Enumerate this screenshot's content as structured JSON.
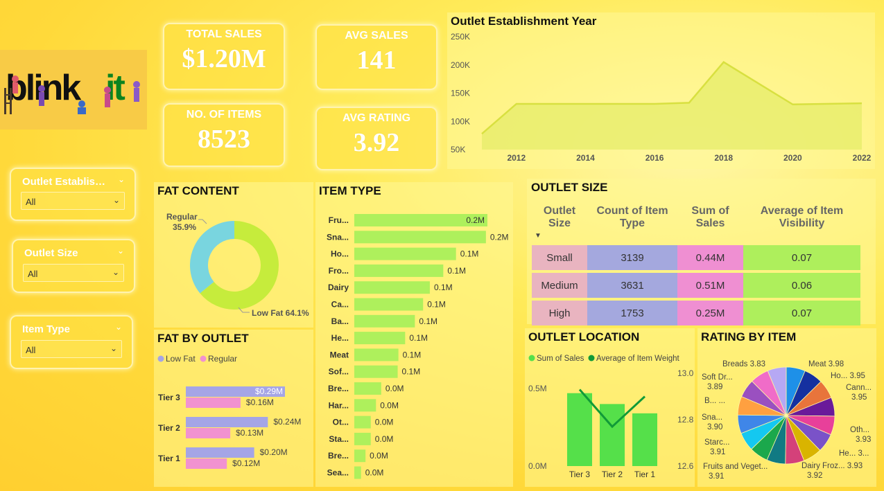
{
  "brand": {
    "logo_text": "blinkit",
    "logo_text_a": "blink",
    "logo_text_b": "it",
    "logo_bg": "#f8cb46",
    "logo_dark": "#111111",
    "logo_green": "#0c831f"
  },
  "kpis": {
    "total_sales": {
      "label": "TOTAL SALES",
      "value": "$1.20M"
    },
    "avg_sales": {
      "label": "AVG SALES",
      "value": "141"
    },
    "no_items": {
      "label": "NO. OF ITEMS",
      "value": "8523"
    },
    "avg_rating": {
      "label": "AVG RATING",
      "value": "3.92"
    }
  },
  "slicers": [
    {
      "title": "Outlet Establis…",
      "value": "All"
    },
    {
      "title": "Outlet Size",
      "value": "All"
    },
    {
      "title": "Item Type",
      "value": "All"
    }
  ],
  "icons": {
    "chevron": "chevron-down-icon",
    "sort": "sort-descending-icon"
  },
  "colors": {
    "low_fat": "#a5a5e6",
    "regular": "#f192d0",
    "bar_green": "#aef05c",
    "cyan": "#79d5df",
    "lime": "#c6ec3c",
    "sales_green": "#55e04a",
    "line_green": "#119a38"
  },
  "establishment": {
    "title": "Outlet Establishment Year",
    "chart_data": {
      "type": "area",
      "x": [
        2011,
        2012,
        2014,
        2016,
        2017,
        2018,
        2020,
        2022
      ],
      "values": [
        78000,
        131000,
        131000,
        131000,
        133000,
        205000,
        130000,
        132000
      ],
      "ylim": [
        50000,
        250000
      ],
      "y_ticks": [
        "250K",
        "200K",
        "150K",
        "100K",
        "50K"
      ],
      "x_ticks": [
        "2012",
        "2014",
        "2016",
        "2018",
        "2020",
        "2022"
      ]
    }
  },
  "fat_content": {
    "title": "FAT CONTENT",
    "chart_data": {
      "type": "pie",
      "categories": [
        "Low Fat",
        "Regular"
      ],
      "values": [
        64.1,
        35.9
      ],
      "labels": {
        "regular_name": "Regular",
        "regular_pct": "35.9%",
        "low": "Low Fat 64.1%"
      }
    }
  },
  "item_type": {
    "title": "ITEM TYPE",
    "chart_data": {
      "type": "bar",
      "categories": [
        "Fru...",
        "Sna...",
        "Ho...",
        "Fro...",
        "Dairy",
        "Ca...",
        "Ba...",
        "He...",
        "Meat",
        "Sof...",
        "Bre...",
        "Har...",
        "Ot...",
        "Sta...",
        "Bre...",
        "Sea..."
      ],
      "values": [
        0.178,
        0.176,
        0.136,
        0.119,
        0.101,
        0.092,
        0.081,
        0.068,
        0.059,
        0.058,
        0.036,
        0.029,
        0.022,
        0.022,
        0.015,
        0.009
      ],
      "value_labels": [
        "0.2M",
        "0.2M",
        "0.1M",
        "0.1M",
        "0.1M",
        "0.1M",
        "0.1M",
        "0.1M",
        "0.1M",
        "0.1M",
        "0.0M",
        "0.0M",
        "0.0M",
        "0.0M",
        "0.0M",
        "0.0M"
      ]
    }
  },
  "fat_by_outlet": {
    "title": "FAT BY OUTLET",
    "legend": [
      "Low Fat",
      "Regular"
    ],
    "chart_data": {
      "type": "bar",
      "categories": [
        "Tier 3",
        "Tier 2",
        "Tier 1"
      ],
      "series": [
        {
          "name": "Low Fat",
          "values": [
            0.29,
            0.24,
            0.2
          ],
          "labels": [
            "$0.29M",
            "$0.24M",
            "$0.20M"
          ]
        },
        {
          "name": "Regular",
          "values": [
            0.16,
            0.13,
            0.12
          ],
          "labels": [
            "$0.16M",
            "$0.13M",
            "$0.12M"
          ]
        }
      ]
    }
  },
  "outlet_size": {
    "title": "OUTLET SIZE",
    "headers": {
      "c1a": "Outlet",
      "c1b": "Size",
      "c2a": "Count of Item",
      "c2b": "Type",
      "c3a": "Sum of",
      "c3b": "Sales",
      "c4a": "Average of Item",
      "c4b": "Visibility"
    },
    "rows": [
      {
        "size": "Small",
        "count": "3139",
        "sales": "0.44M",
        "vis": "0.07"
      },
      {
        "size": "Medium",
        "count": "3631",
        "sales": "0.51M",
        "vis": "0.06"
      },
      {
        "size": "High",
        "count": "1753",
        "sales": "0.25M",
        "vis": "0.07"
      }
    ],
    "col_colors": [
      "#e9b4c0",
      "#a4a8de",
      "#ef8fd2",
      "#aeef5c"
    ]
  },
  "outlet_location": {
    "title": "OUTLET LOCATION",
    "legend": [
      "Sum of Sales",
      "Average of Item Weight"
    ],
    "chart_data": {
      "type": "bar",
      "categories": [
        "Tier 3",
        "Tier 2",
        "Tier 1"
      ],
      "series": [
        {
          "name": "Sum of Sales",
          "values": [
            0.47,
            0.4,
            0.34
          ]
        },
        {
          "name": "Average of Item Weight",
          "values": [
            12.93,
            12.77,
            12.9
          ]
        }
      ],
      "y_left_ticks": [
        "0.5M",
        "0.0M"
      ],
      "y_right_ticks": [
        "13.0",
        "12.8",
        "12.6"
      ]
    }
  },
  "rating_by_item": {
    "title": "RATING BY ITEM",
    "chart_data": {
      "type": "pie",
      "categories": [
        "Meat",
        "Household",
        "Canned",
        "Hard Drinks",
        "Others",
        "Health",
        "Dairy",
        "Frozen",
        "Fruits and Vegetables",
        "Starchy",
        "Snacks",
        "Baking",
        "Soft Drinks",
        "Breads",
        "Seafood",
        "Breakfast"
      ],
      "values": [
        3.98,
        3.95,
        3.95,
        3.92,
        3.93,
        3.93,
        3.92,
        3.93,
        3.91,
        3.91,
        3.9,
        3.89,
        3.89,
        3.83,
        3.9,
        3.92
      ],
      "labels": [
        {
          "l1": "Meat 3.98",
          "l2": ""
        },
        {
          "l1": "Ho... 3.95",
          "l2": ""
        },
        {
          "l1": "Cann...",
          "l2": "3.95"
        },
        {
          "l1": "Oth...",
          "l2": "3.93"
        },
        {
          "l1": "He... 3...",
          "l2": ""
        },
        {
          "l1": "Dairy Froz... 3.93",
          "l2": "3.92"
        },
        {
          "l1": "Fruits and Veget...",
          "l2": "3.91"
        },
        {
          "l1": "Starc...",
          "l2": "3.91"
        },
        {
          "l1": "Sna...",
          "l2": "3.90"
        },
        {
          "l1": "B... ...",
          "l2": ""
        },
        {
          "l1": "Soft Dr...",
          "l2": "3.89"
        },
        {
          "l1": "Breads 3.83",
          "l2": ""
        }
      ],
      "colors": [
        "#1e90e8",
        "#1530a0",
        "#e8743b",
        "#6a1a9a",
        "#e8409a",
        "#7a52c8",
        "#d9b400",
        "#d4417a",
        "#117a83",
        "#1ba84c",
        "#14c8f0",
        "#3f86e8",
        "#ffa040",
        "#9a50c0",
        "#f06cc8",
        "#b6a8f4"
      ]
    }
  }
}
